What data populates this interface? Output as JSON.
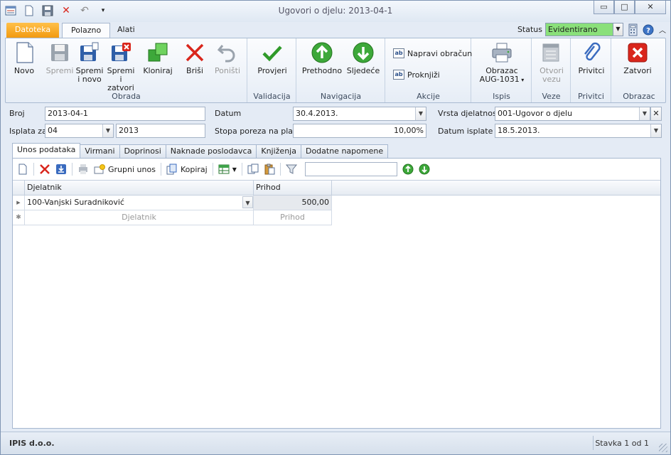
{
  "window": {
    "title": "Ugovori o djelu: 2013-04-1",
    "min_glyph": "▭",
    "max_glyph": "□",
    "close_glyph": "✕"
  },
  "ribbon_tabs": {
    "file": "Datoteka",
    "home": "Polazno",
    "tools": "Alati"
  },
  "status": {
    "label": "Status",
    "value": "Evidentirano"
  },
  "ribbon": {
    "groups": {
      "obrada": "Obrada",
      "validacija": "Validacija",
      "navigacija": "Navigacija",
      "akcije": "Akcije",
      "ispis": "Ispis",
      "veze": "Veze",
      "privitci": "Privitci",
      "obrazac": "Obrazac"
    },
    "buttons": {
      "novo": "Novo",
      "spremi": "Spremi",
      "spremi_novo_1": "Spremi",
      "spremi_novo_2": "i novo",
      "spremi_zatvori_1": "Spremi i",
      "spremi_zatvori_2": "zatvori",
      "kloniraj": "Kloniraj",
      "brisi": "Briši",
      "ponisti": "Poništi",
      "provjeri": "Provjeri",
      "prethodno": "Prethodno",
      "sljedece": "Sljedeće",
      "napravi_obracun": "Napravi obračun",
      "proknjizi": "Proknjiži",
      "obrazac_1": "Obrazac",
      "obrazac_2": "AUG-1031",
      "otvori_vezu_1": "Otvori",
      "otvori_vezu_2": "vezu",
      "privitci": "Privitci",
      "zatvori": "Zatvori"
    }
  },
  "form": {
    "broj_label": "Broj",
    "broj_value": "2013-04-1",
    "datum_label": "Datum",
    "datum_value": "30.4.2013.",
    "vrsta_label": "Vrsta djelatnosti",
    "vrsta_value": "001-Ugovor o djelu",
    "isplata_label": "Isplata za",
    "isplata_month": "04",
    "isplata_year": "2013",
    "stopa_label": "Stopa poreza na plaću",
    "stopa_value": "10,00%",
    "datum_isplate_label": "Datum isplate",
    "datum_isplate_value": "18.5.2013."
  },
  "page_tabs": [
    "Unos podataka",
    "Virmani",
    "Doprinosi",
    "Naknade poslodavca",
    "Knjiženja",
    "Dodatne napomene"
  ],
  "toolbar": {
    "grupni_unos": "Grupni unos",
    "kopiraj": "Kopiraj"
  },
  "grid": {
    "columns": [
      "Djelatnik",
      "Prihod"
    ],
    "rows": [
      {
        "djelatnik": "100-Vanjski Suradniković",
        "prihod": "500,00"
      }
    ],
    "new_row": {
      "djelatnik": "Djelatnik",
      "prihod": "Prihod"
    }
  },
  "statusbar": {
    "company": "IPIS d.o.o.",
    "record": "Stavka 1 od 1"
  },
  "colors": {
    "accent_orange": "#f29a10",
    "status_green": "#8ae07a",
    "navigation_green": "#3da83a",
    "delete_red": "#d9261c"
  }
}
